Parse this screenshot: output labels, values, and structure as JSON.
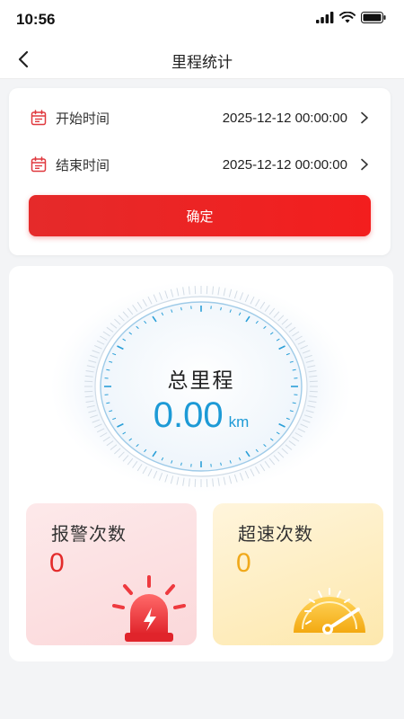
{
  "status_bar": {
    "time": "10:56"
  },
  "nav": {
    "title": "里程统计"
  },
  "date_filter": {
    "start_label": "开始时间",
    "start_value": "2025-12-12 00:00:00",
    "end_label": "结束时间",
    "end_value": "2025-12-12 00:00:00",
    "confirm_label": "确定"
  },
  "mileage": {
    "title": "总里程",
    "value": "0.00",
    "unit": "km"
  },
  "stats": {
    "alarm": {
      "label": "报警次数",
      "count": "0"
    },
    "overspeed": {
      "label": "超速次数",
      "count": "0"
    }
  },
  "colors": {
    "accent_red": "#e52a2a",
    "dial_blue": "#1d9ad6",
    "overspeed_orange": "#f0a91b"
  },
  "icons": {
    "back": "chevron-left-icon",
    "calendar": "calendar-icon",
    "chevron": "chevron-right-icon",
    "alarm": "alarm-siren-icon",
    "speed": "speedometer-icon"
  }
}
